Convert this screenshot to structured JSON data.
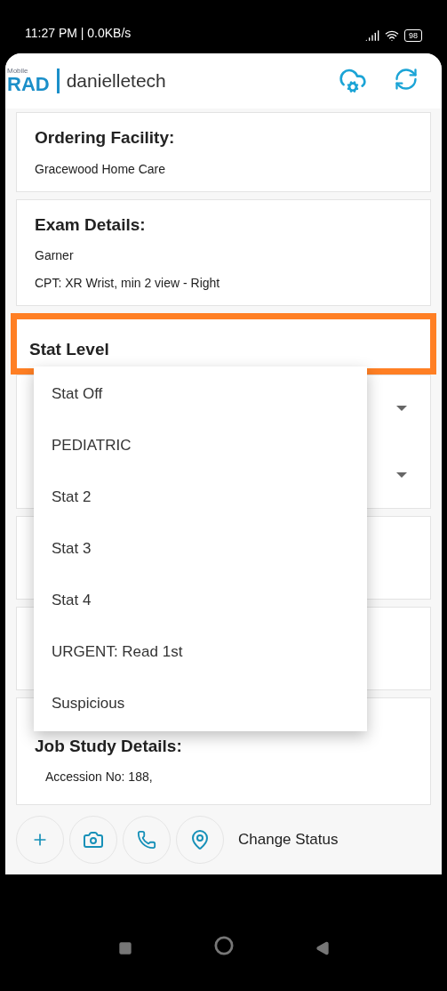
{
  "status_bar": {
    "time": "11:27 PM | 0.0KB/s",
    "battery": "98"
  },
  "header": {
    "logo_small": "Mobile",
    "logo": "RAD",
    "user": "danielletech"
  },
  "cards": [
    {
      "title": "Ordering Facility:",
      "lines": [
        "Gracewood Home Care"
      ]
    },
    {
      "title": "Exam Details:",
      "lines": [
        "Garner",
        "CPT: XR Wrist, min 2 view - Right"
      ]
    }
  ],
  "stat_level": {
    "title": "Stat Level",
    "highlighted": true
  },
  "menu": {
    "options": [
      "Stat Off",
      "PEDIATRIC",
      "Stat 2",
      "Stat 3",
      "Stat 4",
      "URGENT: Read 1st",
      "Suspicious"
    ]
  },
  "job_study": {
    "title": "Job Study Details:",
    "lines": [
      "Accession No: 188,"
    ]
  },
  "bottom_bar": {
    "change_status": "Change Status"
  }
}
